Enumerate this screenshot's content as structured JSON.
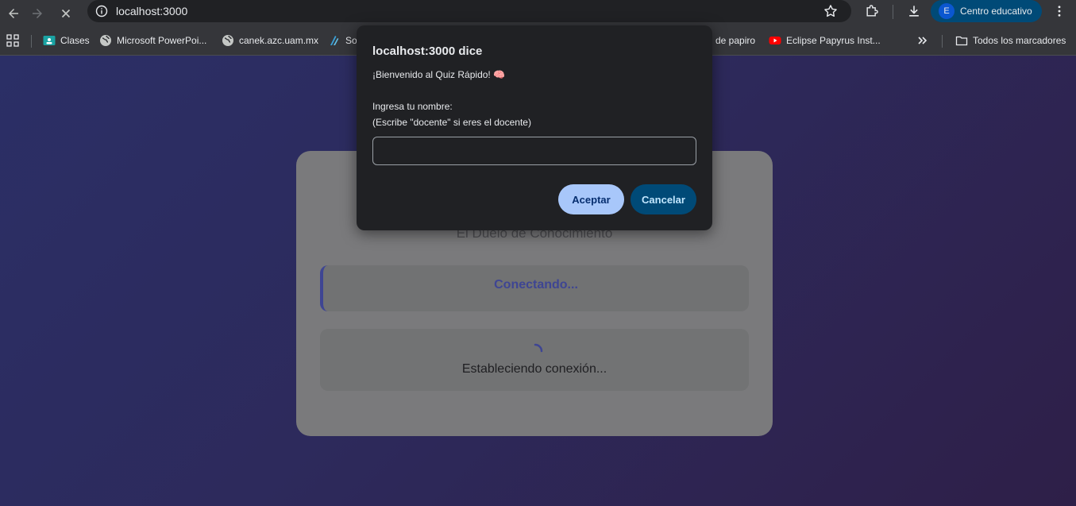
{
  "browser": {
    "url": "localhost:3000",
    "profile_initial": "E",
    "profile_name": "Centro educativo"
  },
  "bookmarks": {
    "items": [
      {
        "label": "Clases",
        "icon": "classroom-icon"
      },
      {
        "label": "Microsoft PowerPoi...",
        "icon": "globe-icon"
      },
      {
        "label": "canek.azc.uam.mx",
        "icon": "globe-icon"
      },
      {
        "label": "So",
        "icon": "bookmark-site-icon"
      },
      {
        "label": "de papiro",
        "icon": ""
      },
      {
        "label": "Eclipse Papyrus Inst...",
        "icon": "youtube-icon"
      }
    ],
    "all_bookmarks_label": "Todos los marcadores"
  },
  "page": {
    "subtitle": "El Duelo de Conocimiento",
    "status": "Conectando...",
    "loading_text": "Estableciendo conexión..."
  },
  "dialog": {
    "title": "localhost:3000 dice",
    "welcome": "¡Bienvenido al Quiz Rápido! 🧠",
    "prompt_line1": "Ingresa tu nombre:",
    "prompt_line2": "(Escribe \"docente\" si eres el docente)",
    "input_value": "",
    "ok_label": "Aceptar",
    "cancel_label": "Cancelar"
  },
  "colors": {
    "accent": "#a8c7fa",
    "cancel_bg": "#004a77",
    "status_color": "#3e4593"
  }
}
